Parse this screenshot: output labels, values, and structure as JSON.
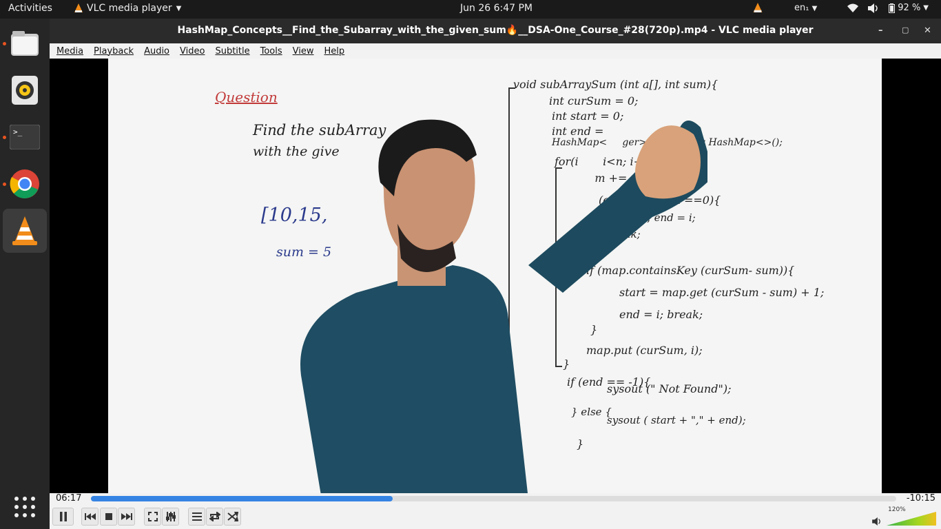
{
  "topbar": {
    "activities": "Activities",
    "app_name": "VLC media player",
    "clock": "Jun 26  6:47 PM",
    "lang": "en₁",
    "battery": "92 %"
  },
  "window": {
    "title": "HashMap_Concepts__Find_the_Subarray_with_the_given_sum🔥__DSA-One_Course_#28(720p).mp4 - VLC media player"
  },
  "menu": [
    "Media",
    "Playback",
    "Audio",
    "Video",
    "Subtitle",
    "Tools",
    "View",
    "Help"
  ],
  "player": {
    "elapsed": "06:17",
    "remaining": "-10:15",
    "progress": 0.375,
    "volume": "120%"
  },
  "board": {
    "question": "Question",
    "q1": "Find the subArray",
    "q2": "with the give",
    "arr": "[10,15,",
    "sum": "sum = 5",
    "code": [
      "void subArraySum (int a[], int sum){",
      "int curSum = 0;",
      "int start = 0;",
      "int end =",
      "HashMap<     ger> map = new HashMap<>();",
      "for(i       i<n; i++){",
      "    m += a[i];",
      "(curSum - sum ==0){",
      "start =0; end = i;",
      "break;",
      "}",
      "if (map.containsKey (curSum- sum)){",
      "start = map.get (curSum - sum) + 1;",
      "end = i; break;",
      "}",
      "map.put (curSum, i);",
      "}",
      "if (end == -1){",
      "sysout (\" Not Found\");",
      "} else {",
      "sysout ( start + \",\" + end);",
      "}",
      "}"
    ]
  }
}
